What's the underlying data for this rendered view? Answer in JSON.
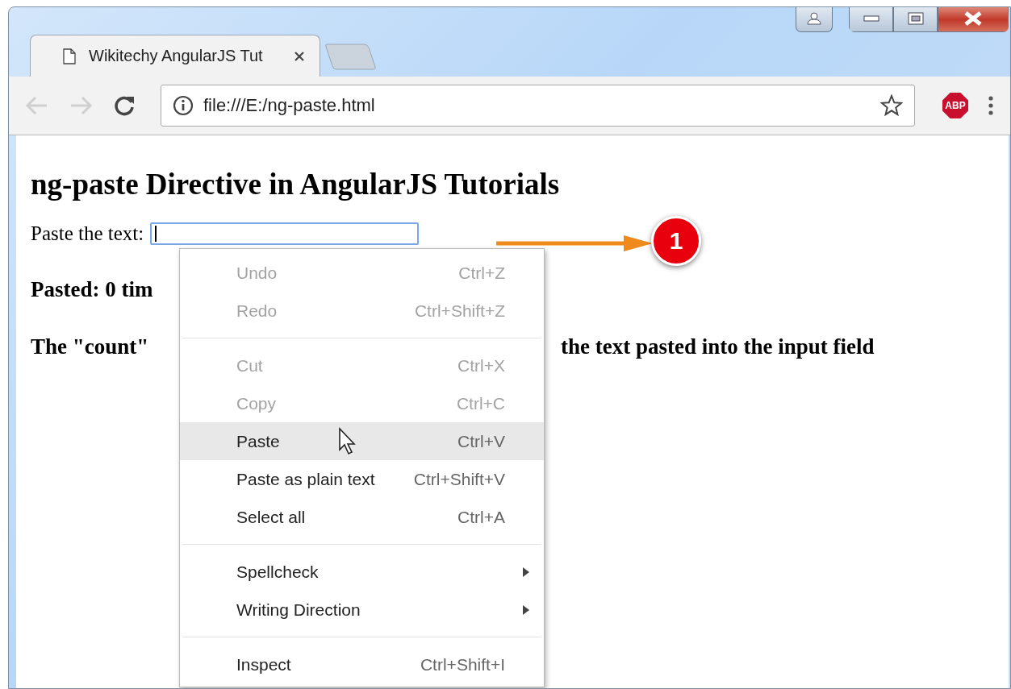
{
  "navigation": {
    "back_disabled": true,
    "forward_disabled": true
  },
  "tabs": [
    {
      "title": "Wikitechy AngularJS Tut",
      "selected": true
    }
  ],
  "address_bar": {
    "url": "file:///E:/ng-paste.html"
  },
  "extension": {
    "label": "ABP"
  },
  "page": {
    "heading": "ng-paste Directive in AngularJS Tutorials",
    "input_label": "Paste the text:",
    "input": {
      "focused": true
    },
    "pasted_text": "Pasted: 0 tim",
    "count_text": [
      "The \"count\"",
      "the text pasted into the input field"
    ]
  },
  "context_menu": {
    "items": [
      {
        "kind": "item",
        "label": "Undo",
        "shortcut": "Ctrl+Z",
        "disabled": true,
        "selected": false
      },
      {
        "kind": "item",
        "label": "Redo",
        "shortcut": "Ctrl+Shift+Z",
        "disabled": true,
        "selected": false
      },
      {
        "kind": "separator"
      },
      {
        "kind": "item",
        "label": "Cut",
        "shortcut": "Ctrl+X",
        "disabled": true,
        "selected": false
      },
      {
        "kind": "item",
        "label": "Copy",
        "shortcut": "Ctrl+C",
        "disabled": true,
        "selected": false
      },
      {
        "kind": "item",
        "label": "Paste",
        "shortcut": "Ctrl+V",
        "disabled": false,
        "selected": true
      },
      {
        "kind": "item",
        "label": "Paste as plain text",
        "shortcut": "Ctrl+Shift+V",
        "disabled": false,
        "selected": false
      },
      {
        "kind": "item",
        "label": "Select all",
        "shortcut": "Ctrl+A",
        "disabled": false,
        "selected": false
      },
      {
        "kind": "separator"
      },
      {
        "kind": "submenu",
        "label": "Spellcheck",
        "disabled": false,
        "selected": false
      },
      {
        "kind": "submenu",
        "label": "Writing Direction",
        "disabled": false,
        "selected": false
      },
      {
        "kind": "separator"
      },
      {
        "kind": "item",
        "label": "Inspect",
        "shortcut": "Ctrl+Shift+I",
        "disabled": false,
        "selected": false
      }
    ]
  },
  "annotation": {
    "number": "1"
  }
}
